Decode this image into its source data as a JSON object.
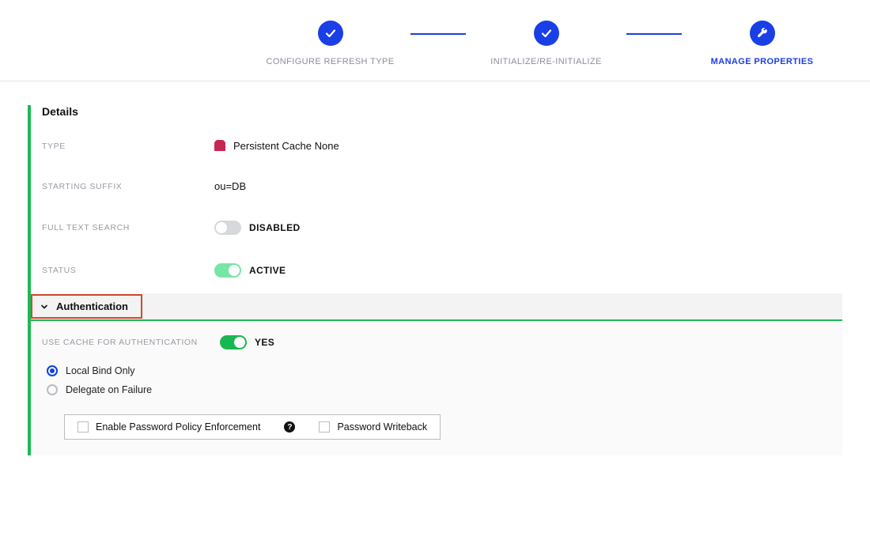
{
  "stepper": {
    "steps": [
      {
        "label": "CONFIGURE REFRESH TYPE",
        "state": "done"
      },
      {
        "label": "INITIALIZE/RE-INITIALIZE",
        "state": "done"
      },
      {
        "label": "MANAGE PROPERTIES",
        "state": "current"
      }
    ]
  },
  "details": {
    "title": "Details",
    "rows": {
      "type": {
        "label": "TYPE",
        "value": "Persistent Cache None"
      },
      "suffix": {
        "label": "STARTING SUFFIX",
        "value": "ou=DB"
      },
      "fts": {
        "label": "FULL TEXT SEARCH",
        "state": "off",
        "state_label": "DISABLED"
      },
      "status": {
        "label": "STATUS",
        "state": "on-light",
        "state_label": "ACTIVE"
      }
    }
  },
  "auth": {
    "header": "Authentication",
    "use_cache": {
      "label": "USE CACHE FOR AUTHENTICATION",
      "state": "on",
      "state_label": "YES"
    },
    "bind_options": {
      "local": "Local Bind Only",
      "delegate": "Delegate on Failure",
      "selected": "local"
    },
    "checkboxes": {
      "enforce": {
        "label": "Enable Password Policy Enforcement",
        "checked": false
      },
      "writeback": {
        "label": "Password Writeback",
        "checked": false
      }
    }
  }
}
